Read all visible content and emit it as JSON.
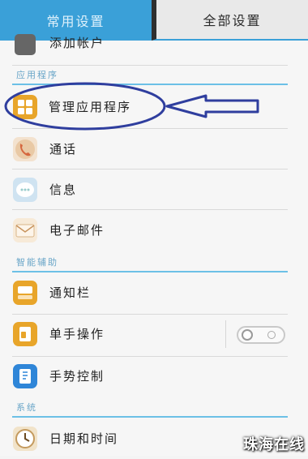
{
  "tabs": {
    "common": "常用设置",
    "all": "全部设置"
  },
  "partial_row": {
    "label": "添加帐户"
  },
  "sections": {
    "apps": "应用程序",
    "smart": "智能辅助",
    "system": "系统"
  },
  "items": {
    "manage_apps": "管理应用程序",
    "phone": "通话",
    "messages": "信息",
    "email": "电子邮件",
    "notification_bar": "通知栏",
    "one_hand": "单手操作",
    "gesture": "手势控制",
    "date_time": "日期和时间"
  },
  "watermark": "珠海在线",
  "colors": {
    "accent": "#3aa0d8",
    "annotation": "#2f3e9e",
    "section_line": "#6cc0e6"
  }
}
